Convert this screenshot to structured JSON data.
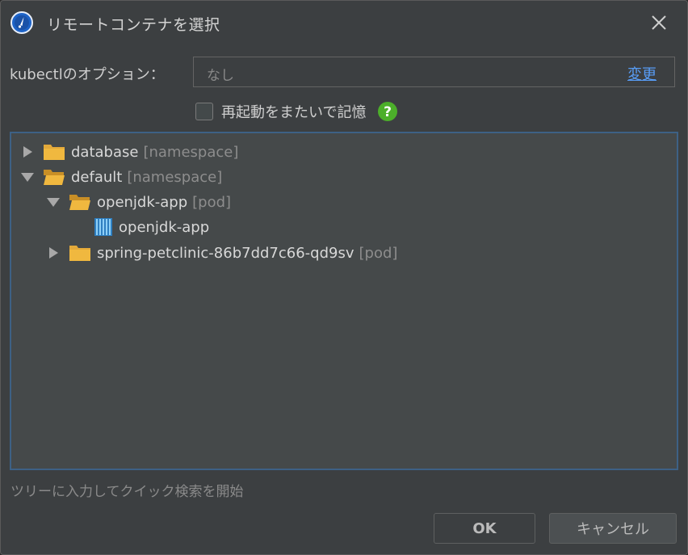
{
  "dialog": {
    "title": "リモートコンテナを選択"
  },
  "options": {
    "label": "kubectlのオプション：",
    "value": "なし",
    "change_link": "変更"
  },
  "restart": {
    "label": "再起動をまたいで記憶",
    "checked": false
  },
  "tree": {
    "nodes": [
      {
        "name": "database",
        "type": "[namespace]",
        "expanded": false
      },
      {
        "name": "default",
        "type": "[namespace]",
        "expanded": true
      },
      {
        "name": "openjdk-app",
        "type": "[pod]",
        "expanded": true
      },
      {
        "name": "openjdk-app",
        "type": ""
      },
      {
        "name": "spring-petclinic-86b7dd7c66-qd9sv",
        "type": "[pod]",
        "expanded": false
      }
    ]
  },
  "hint": "ツリーに入力してクイック検索を開始",
  "buttons": {
    "ok": "OK",
    "cancel": "キャンセル"
  },
  "colors": {
    "background": "#3c3f41",
    "tree_background": "#45494a",
    "tree_border": "#3d6185",
    "link": "#589df6",
    "folder": "#e3a93a",
    "help": "#4caf2a"
  }
}
